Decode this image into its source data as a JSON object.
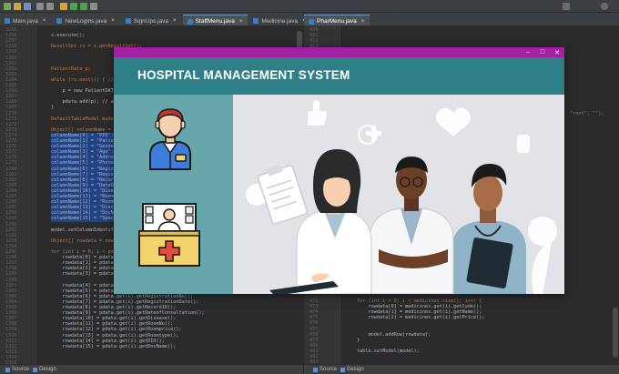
{
  "editor_left": {
    "tabs": [
      {
        "label": "Main.java",
        "active": false
      },
      {
        "label": "NewLogins.java",
        "active": false
      },
      {
        "label": "SignUps.java",
        "active": false
      },
      {
        "label": "StaffMenu.java",
        "active": true
      },
      {
        "label": "Medicine.java",
        "active": false
      }
    ],
    "line_numbers": [
      "1255",
      "1256",
      "1257",
      "1258",
      "1259",
      "1260",
      "1261",
      "1262",
      "1263",
      "1264",
      "1265",
      "1266",
      "1267",
      "1268",
      "1269",
      "1270",
      "1271",
      "1272",
      "1273",
      "1274",
      "1275",
      "1276",
      "1277",
      "1278",
      "1279",
      "1280",
      "1281",
      "1282",
      "1283",
      "1284",
      "1285",
      "1286",
      "1287",
      "1288",
      "1289",
      "1290",
      "1291",
      "1292",
      "1293",
      "1294",
      "1295",
      "1296",
      "1297",
      "1298",
      "1299",
      "1300",
      "1301",
      "1302",
      "1303",
      "1304",
      "1305",
      "1306",
      "1307",
      "1308",
      "1309",
      "1310",
      "1311",
      "1312",
      "1313",
      "1314",
      "1315"
    ],
    "code_lines": [
      "",
      "s.execute();",
      "",
      "ResultSet rs = s.getResultSet();",
      "",
      "",
      "",
      "PatientData p;",
      "",
      "while (rs.next()) { // L",
      "",
      "    p = new PatientDATA(",
      "",
      "    pdata.add(p); // add",
      "}",
      "",
      "DefaultTableModel model",
      "",
      "Object[] columnName = n",
      "columnName[0] = \"PID\";",
      "columnName[1] = \"Patien",
      "columnName[2] = \"Gender",
      "columnName[3] = \"Age\";",
      "columnName[4] = \"Addres",
      "columnName[5] = \"Phone",
      "columnName[6] = \"Regist",
      "columnName[7] = \"Regist",
      "columnName[8] = \"Record",
      "columnName[9] = \"DateOf",
      "columnName[10] = \"Disea",
      "columnName[11] = \"Room",
      "columnName[12] = \"RoomT",
      "columnName[13] = \"Disch",
      "columnName[14] = \"DocNa",
      "columnName[15] = \"Speci",
      "",
      "model.setColumnIdentifie",
      "",
      "Object[] rowdata = new O",
      "",
      "for (int i = 0; i < pdat",
      "    rowdata[0] = pdata.",
      "    rowdata[1] = pdata.",
      "    rowdata[2] = pdata.",
      "    rowdata[3] = pdata.",
      "",
      "    rowdata[4] = pdata.get(i).getAddress();",
      "    rowdata[5] = pdata.get(i).getPhoneNo();",
      "    rowdata[6] = pdata.get(i).getRegistrationNo();",
      "    rowdata[7] = pdata.get(i).getRegistrationDate();",
      "    rowdata[8] = pdata.get(i).getRecordID();",
      "    rowdata[9] = pdata.get(i).getDateofConsultation();",
      "    rowdata[10] = pdata.get(i).getDisease();",
      "    rowdata[11] = pdata.get(i).getRoomNo();",
      "    rowdata[12] = pdata.get(i).getRoomprice();",
      "    rowdata[13] = pdata.get(i).getRoomtype();",
      "    rowdata[14] = pdata.get(i).getDID();",
      "    rowdata[15] = pdata.get(i).getDocName();"
    ],
    "bottom_tabs": [
      "Source",
      "Design"
    ]
  },
  "editor_right": {
    "tabs": [
      {
        "label": "PharMenu.java",
        "active": true
      }
    ],
    "top_line_numbers": [
      "420",
      "421",
      "422",
      "423",
      "424"
    ],
    "top_code": "private void initTableData(JTable table) {",
    "inline_str": "\"rent\", \"\");",
    "bottom_line_numbers": [
      "472",
      "473",
      "474",
      "475",
      "476",
      "477",
      "478",
      "479",
      "480",
      "481",
      "482",
      "483"
    ],
    "bottom_code_lines": [
      "for (int i = 0; i < medicines.size(); i++) {",
      "    rowdata[0] = medicines.get(i).getCode();",
      "    rowdata[1] = medicines.get(i).getName();",
      "    rowdata[2] = medicines.get(i).getPrice();",
      "",
      "",
      "    model.addRow(rowdata);",
      "}",
      "",
      "table.setModel(model);",
      "",
      ""
    ],
    "bottom_tabs": [
      "Source",
      "Design"
    ]
  },
  "window": {
    "title_bar": {
      "minimize": "–",
      "maximize": "□",
      "close": "✕"
    },
    "header_title": "HOSPITAL MANAGEMENT SYSTEM",
    "colors": {
      "title_bar": "#a61ea3",
      "header": "#2e7f87",
      "sidebar": "#66a7ac",
      "illustration_bg": "#e2e3e7"
    },
    "sidebar_icons": [
      "staff-avatar-icon",
      "medicine-cabinet-icon"
    ]
  }
}
